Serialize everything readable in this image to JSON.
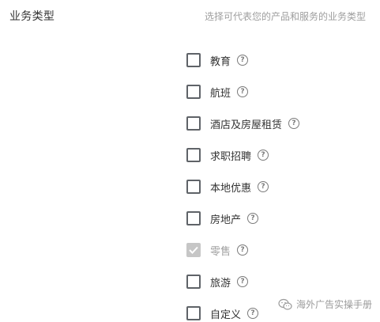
{
  "section": {
    "title": "业务类型",
    "description": "选择可代表您的产品和服务的业务类型"
  },
  "options": [
    {
      "label": "教育",
      "checked": false,
      "disabled": false
    },
    {
      "label": "航班",
      "checked": false,
      "disabled": false
    },
    {
      "label": "酒店及房屋租赁",
      "checked": false,
      "disabled": false
    },
    {
      "label": "求职招聘",
      "checked": false,
      "disabled": false
    },
    {
      "label": "本地优惠",
      "checked": false,
      "disabled": false
    },
    {
      "label": "房地产",
      "checked": false,
      "disabled": false
    },
    {
      "label": "零售",
      "checked": true,
      "disabled": true
    },
    {
      "label": "旅游",
      "checked": false,
      "disabled": false
    },
    {
      "label": "自定义",
      "checked": false,
      "disabled": false
    }
  ],
  "help_icon_glyph": "?",
  "watermark": {
    "text": "海外广告实操手册"
  },
  "colors": {
    "checkbox_border": "#5f6368",
    "disabled_fill": "#c6c6c6",
    "description_text": "#9e9e9e"
  }
}
